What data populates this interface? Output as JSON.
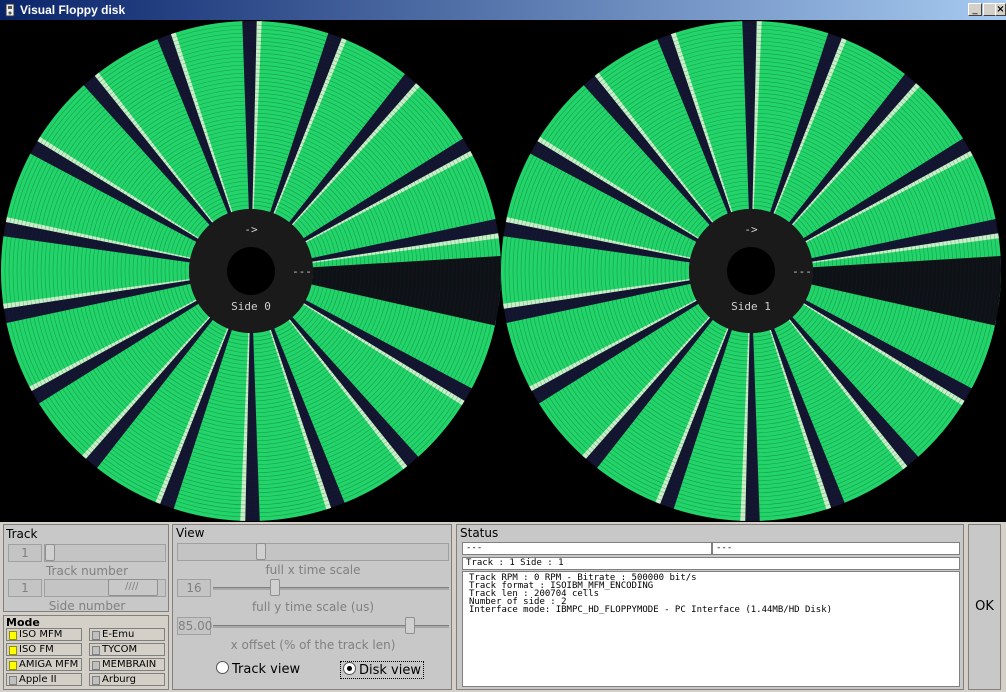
{
  "window": {
    "title": "Visual Floppy disk",
    "controls": [
      "_",
      "□",
      "×"
    ]
  },
  "canvas": {
    "disks": [
      {
        "arrow_label": "->",
        "index_label": "---",
        "side_label": "Side 0"
      },
      {
        "arrow_label": "->",
        "index_label": "---",
        "side_label": "Side 1"
      }
    ],
    "colors": {
      "sector": "#22d46a",
      "gap": "#141432",
      "background": "#000000",
      "hub": "#1a1a1a"
    }
  },
  "track_group": {
    "title": "Track",
    "track_value": "1",
    "track_label": "Track number",
    "side_value": "1",
    "side_label": "Side number",
    "side_slider_position": 1.0
  },
  "mode_group": {
    "title": "Mode",
    "buttons": [
      {
        "label": "ISO MFM",
        "on": true
      },
      {
        "label": "E-Emu",
        "on": false
      },
      {
        "label": "ISO FM",
        "on": true
      },
      {
        "label": "TYCOM",
        "on": false
      },
      {
        "label": "AMIGA MFM",
        "on": true
      },
      {
        "label": "MEMBRAIN",
        "on": false
      },
      {
        "label": "Apple II",
        "on": false
      },
      {
        "label": "Arburg",
        "on": false
      }
    ]
  },
  "view_group": {
    "title": "View",
    "x_scale_label": "full x time scale",
    "x_scale_position": 0.3,
    "y_scale_value": "16",
    "y_scale_label": "full y time scale (us)",
    "y_scale_position": 0.25,
    "offset_value": "85.00",
    "offset_label": "x offset (% of the track len)",
    "offset_position": 0.85,
    "radio_track": "Track view",
    "radio_disk": "Disk view",
    "selected": "disk"
  },
  "status_group": {
    "title": "Status",
    "field_left": "---",
    "field_right": "---",
    "track_side": "Track : 1 Side : 1",
    "info_lines": [
      "Track RPM : 0 RPM - Bitrate : 500000 bit/s",
      "Track format : ISOIBM_MFM_ENCODING",
      "Track len : 200704 cells",
      "Number of side : 2",
      "Interface mode: IBMPC_HD_FLOPPYMODE - PC Interface (1.44MB/HD Disk)"
    ]
  },
  "ok_button": {
    "label": "OK"
  }
}
